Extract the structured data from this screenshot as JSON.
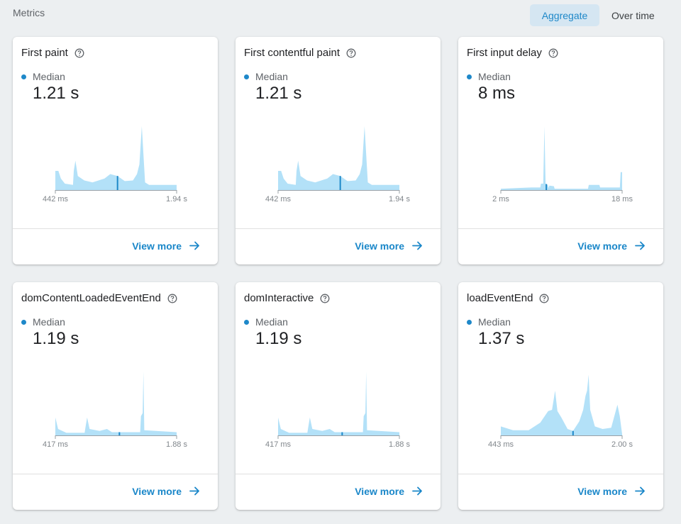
{
  "header": {
    "section_label": "Metrics",
    "toggle_aggregate": "Aggregate",
    "toggle_over_time": "Over time"
  },
  "colors": {
    "accent": "#1e88c9",
    "fill": "#b3e1f8",
    "toggle_bg": "#d5e6f2"
  },
  "cards": [
    {
      "title": "First paint",
      "median_label": "Median",
      "median_value": "1.21 s",
      "x_min_label": "442 ms",
      "x_max_label": "1.94 s",
      "view_more": "View more"
    },
    {
      "title": "First contentful paint",
      "median_label": "Median",
      "median_value": "1.21 s",
      "x_min_label": "442 ms",
      "x_max_label": "1.94 s",
      "view_more": "View more"
    },
    {
      "title": "First input delay",
      "median_label": "Median",
      "median_value": "8 ms",
      "x_min_label": "2 ms",
      "x_max_label": "18 ms",
      "view_more": "View more"
    },
    {
      "title": "domContentLoadedEventEnd",
      "median_label": "Median",
      "median_value": "1.19 s",
      "x_min_label": "417 ms",
      "x_max_label": "1.88 s",
      "view_more": "View more"
    },
    {
      "title": "domInteractive",
      "median_label": "Median",
      "median_value": "1.19 s",
      "x_min_label": "417 ms",
      "x_max_label": "1.88 s",
      "view_more": "View more"
    },
    {
      "title": "loadEventEnd",
      "median_label": "Median",
      "median_value": "1.37 s",
      "x_min_label": "443 ms",
      "x_max_label": "2.00 s",
      "view_more": "View more"
    }
  ],
  "chart_data": [
    {
      "type": "area",
      "title": "First paint",
      "x_range": [
        0.442,
        1.94
      ],
      "x_unit": "s",
      "median": 1.21,
      "points": [
        [
          0.442,
          0.3
        ],
        [
          0.48,
          0.3
        ],
        [
          0.51,
          0.18
        ],
        [
          0.56,
          0.1
        ],
        [
          0.66,
          0.08
        ],
        [
          0.67,
          0.3
        ],
        [
          0.69,
          0.46
        ],
        [
          0.72,
          0.22
        ],
        [
          0.8,
          0.15
        ],
        [
          0.9,
          0.12
        ],
        [
          1.05,
          0.18
        ],
        [
          1.12,
          0.25
        ],
        [
          1.21,
          0.22
        ],
        [
          1.3,
          0.14
        ],
        [
          1.4,
          0.15
        ],
        [
          1.45,
          0.25
        ],
        [
          1.48,
          0.4
        ],
        [
          1.51,
          1.0
        ],
        [
          1.55,
          0.12
        ],
        [
          1.6,
          0.08
        ],
        [
          1.94,
          0.08
        ]
      ]
    },
    {
      "type": "area",
      "title": "First contentful paint",
      "x_range": [
        0.442,
        1.94
      ],
      "x_unit": "s",
      "median": 1.21,
      "points": [
        [
          0.442,
          0.3
        ],
        [
          0.48,
          0.3
        ],
        [
          0.51,
          0.18
        ],
        [
          0.56,
          0.1
        ],
        [
          0.66,
          0.08
        ],
        [
          0.67,
          0.3
        ],
        [
          0.69,
          0.46
        ],
        [
          0.72,
          0.22
        ],
        [
          0.8,
          0.15
        ],
        [
          0.9,
          0.12
        ],
        [
          1.05,
          0.18
        ],
        [
          1.12,
          0.25
        ],
        [
          1.21,
          0.22
        ],
        [
          1.3,
          0.14
        ],
        [
          1.4,
          0.15
        ],
        [
          1.45,
          0.25
        ],
        [
          1.48,
          0.4
        ],
        [
          1.51,
          1.0
        ],
        [
          1.55,
          0.12
        ],
        [
          1.6,
          0.08
        ],
        [
          1.94,
          0.08
        ]
      ]
    },
    {
      "type": "area",
      "title": "First input delay",
      "x_range": [
        2,
        18
      ],
      "x_unit": "ms",
      "median": 8,
      "points": [
        [
          2,
          0.02
        ],
        [
          4,
          0.03
        ],
        [
          6,
          0.04
        ],
        [
          7.2,
          0.04
        ],
        [
          7.3,
          0.1
        ],
        [
          7.6,
          0.1
        ],
        [
          7.75,
          1.0
        ],
        [
          7.9,
          0.1
        ],
        [
          8.2,
          0.08
        ],
        [
          8.3,
          0.03
        ],
        [
          8.4,
          0.07
        ],
        [
          9.0,
          0.06
        ],
        [
          9.1,
          0.02
        ],
        [
          13.5,
          0.02
        ],
        [
          13.6,
          0.08
        ],
        [
          15.0,
          0.08
        ],
        [
          15.1,
          0.04
        ],
        [
          17.7,
          0.04
        ],
        [
          17.8,
          0.28
        ],
        [
          18,
          0.28
        ]
      ]
    },
    {
      "type": "area",
      "title": "domContentLoadedEventEnd",
      "x_range": [
        0.417,
        1.88
      ],
      "x_unit": "s",
      "median": 1.19,
      "points": [
        [
          0.417,
          0.28
        ],
        [
          0.45,
          0.1
        ],
        [
          0.55,
          0.04
        ],
        [
          0.77,
          0.04
        ],
        [
          0.78,
          0.12
        ],
        [
          0.8,
          0.28
        ],
        [
          0.83,
          0.1
        ],
        [
          0.95,
          0.07
        ],
        [
          1.04,
          0.1
        ],
        [
          1.1,
          0.05
        ],
        [
          1.25,
          0.05
        ],
        [
          1.35,
          0.05
        ],
        [
          1.44,
          0.05
        ],
        [
          1.45,
          0.3
        ],
        [
          1.47,
          0.35
        ],
        [
          1.48,
          1.0
        ],
        [
          1.49,
          0.08
        ],
        [
          1.88,
          0.05
        ]
      ]
    },
    {
      "type": "area",
      "title": "domInteractive",
      "x_range": [
        0.417,
        1.88
      ],
      "x_unit": "s",
      "median": 1.19,
      "points": [
        [
          0.417,
          0.28
        ],
        [
          0.45,
          0.1
        ],
        [
          0.55,
          0.04
        ],
        [
          0.77,
          0.04
        ],
        [
          0.78,
          0.12
        ],
        [
          0.8,
          0.28
        ],
        [
          0.83,
          0.1
        ],
        [
          0.95,
          0.07
        ],
        [
          1.04,
          0.1
        ],
        [
          1.1,
          0.05
        ],
        [
          1.25,
          0.05
        ],
        [
          1.35,
          0.05
        ],
        [
          1.44,
          0.05
        ],
        [
          1.45,
          0.3
        ],
        [
          1.47,
          0.35
        ],
        [
          1.48,
          1.0
        ],
        [
          1.49,
          0.08
        ],
        [
          1.88,
          0.05
        ]
      ]
    },
    {
      "type": "area",
      "title": "loadEventEnd",
      "x_range": [
        0.443,
        2.0
      ],
      "x_unit": "s",
      "median": 1.37,
      "points": [
        [
          0.443,
          0.14
        ],
        [
          0.6,
          0.08
        ],
        [
          0.8,
          0.08
        ],
        [
          0.95,
          0.2
        ],
        [
          1.05,
          0.38
        ],
        [
          1.1,
          0.4
        ],
        [
          1.14,
          0.7
        ],
        [
          1.17,
          0.38
        ],
        [
          1.22,
          0.28
        ],
        [
          1.3,
          0.1
        ],
        [
          1.37,
          0.07
        ],
        [
          1.45,
          0.22
        ],
        [
          1.5,
          0.4
        ],
        [
          1.53,
          0.62
        ],
        [
          1.55,
          0.7
        ],
        [
          1.57,
          0.95
        ],
        [
          1.59,
          0.4
        ],
        [
          1.65,
          0.14
        ],
        [
          1.75,
          0.1
        ],
        [
          1.86,
          0.12
        ],
        [
          1.94,
          0.48
        ],
        [
          1.97,
          0.3
        ],
        [
          2.0,
          0.02
        ]
      ]
    }
  ]
}
